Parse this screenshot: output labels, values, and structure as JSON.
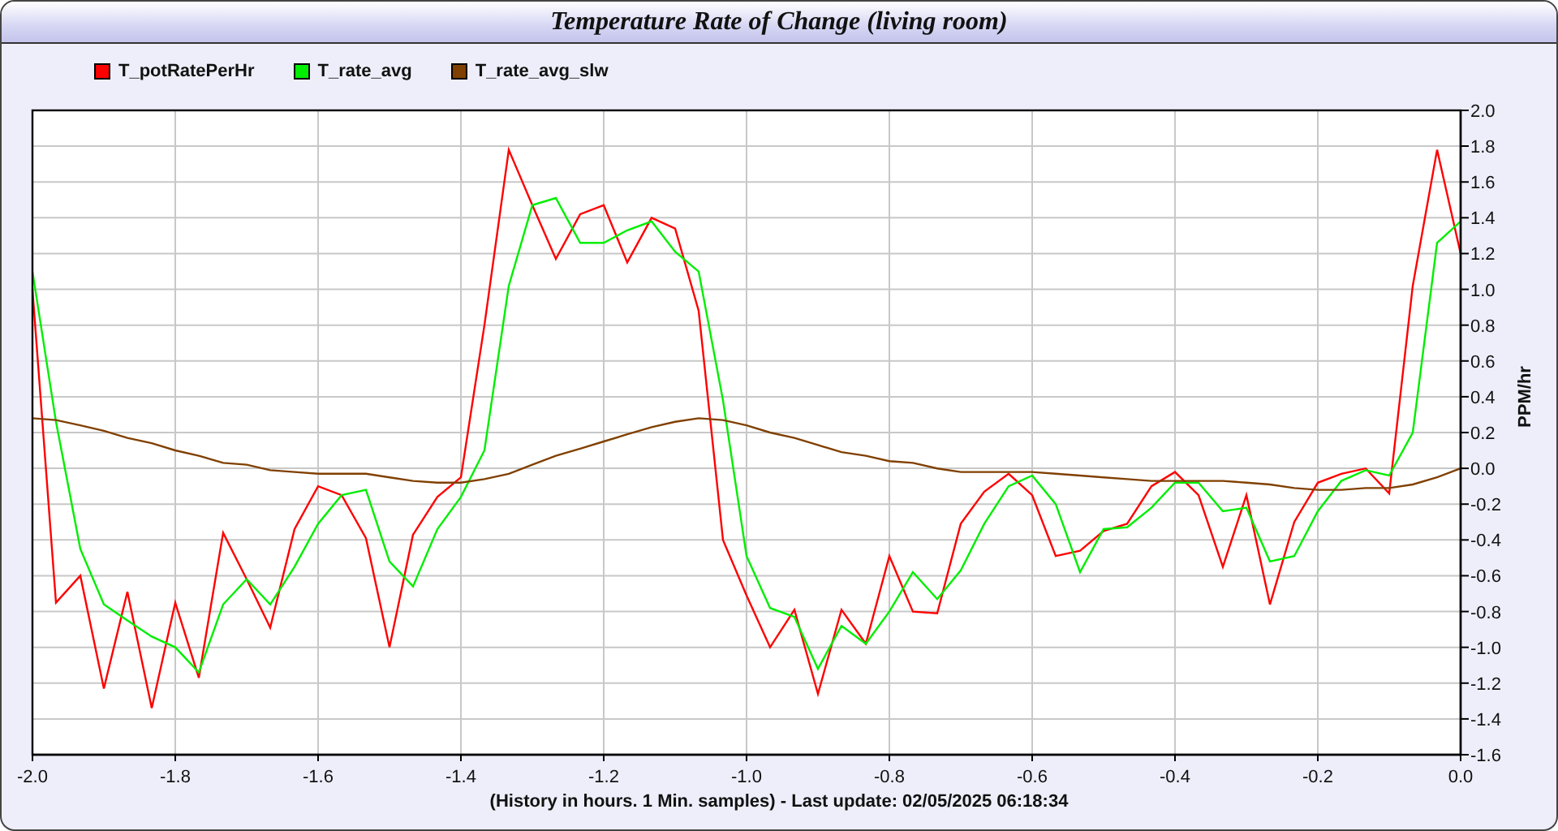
{
  "window": {
    "title": "Temperature Rate of Change (living room)"
  },
  "chart_data": {
    "type": "line",
    "xlabel": "(History in hours. 1 Min. samples) - Last update: 02/05/2025 06:18:34",
    "ylabel": "PPM/hr",
    "grid": true,
    "xlim": [
      -2.0,
      0.0
    ],
    "ylim": [
      -1.6,
      2.0
    ],
    "xticks": [
      {
        "value": -2.0,
        "label": "-2.0"
      },
      {
        "value": -1.8,
        "label": "-1.8"
      },
      {
        "value": -1.6,
        "label": "-1.6"
      },
      {
        "value": -1.4,
        "label": "-1.4"
      },
      {
        "value": -1.2,
        "label": "-1.2"
      },
      {
        "value": -1.0,
        "label": "-1.0"
      },
      {
        "value": -0.8,
        "label": "-0.8"
      },
      {
        "value": -0.6,
        "label": "-0.6"
      },
      {
        "value": -0.4,
        "label": "-0.4"
      },
      {
        "value": -0.2,
        "label": "-0.2"
      },
      {
        "value": 0.0,
        "label": "0.0"
      }
    ],
    "yticks": [
      {
        "value": 2.0,
        "label": "2.0"
      },
      {
        "value": 1.8,
        "label": "1.8"
      },
      {
        "value": 1.6,
        "label": "1.6"
      },
      {
        "value": 1.4,
        "label": "1.4"
      },
      {
        "value": 1.2,
        "label": "1.2"
      },
      {
        "value": 1.0,
        "label": "1.0"
      },
      {
        "value": 0.8,
        "label": "0.8"
      },
      {
        "value": 0.6,
        "label": "0.6"
      },
      {
        "value": 0.4,
        "label": "0.4"
      },
      {
        "value": 0.2,
        "label": "0.2"
      },
      {
        "value": 0.0,
        "label": "0.0"
      },
      {
        "value": -0.2,
        "label": "-0.2"
      },
      {
        "value": -0.4,
        "label": "-0.4"
      },
      {
        "value": -0.6,
        "label": "-0.6"
      },
      {
        "value": -0.8,
        "label": "-0.8"
      },
      {
        "value": -1.0,
        "label": "-1.0"
      },
      {
        "value": -1.2,
        "label": "-1.2"
      },
      {
        "value": -1.4,
        "label": "-1.4"
      },
      {
        "value": -1.6,
        "label": "-1.6"
      }
    ],
    "x": [
      -2.0,
      -1.967,
      -1.933,
      -1.9,
      -1.867,
      -1.833,
      -1.8,
      -1.767,
      -1.733,
      -1.7,
      -1.667,
      -1.633,
      -1.6,
      -1.567,
      -1.533,
      -1.5,
      -1.467,
      -1.433,
      -1.4,
      -1.367,
      -1.333,
      -1.3,
      -1.267,
      -1.233,
      -1.2,
      -1.167,
      -1.133,
      -1.1,
      -1.067,
      -1.033,
      -1.0,
      -0.967,
      -0.933,
      -0.9,
      -0.867,
      -0.833,
      -0.8,
      -0.767,
      -0.733,
      -0.7,
      -0.667,
      -0.633,
      -0.6,
      -0.567,
      -0.533,
      -0.5,
      -0.467,
      -0.433,
      -0.4,
      -0.367,
      -0.333,
      -0.3,
      -0.267,
      -0.233,
      -0.2,
      -0.167,
      -0.133,
      -0.1,
      -0.067,
      -0.033,
      0.0
    ],
    "series": [
      {
        "name": "T_potRatePerHr",
        "color": "#ff0000",
        "values": [
          1.0,
          -0.75,
          -0.6,
          -1.23,
          -0.69,
          -1.34,
          -0.75,
          -1.17,
          -0.36,
          -0.62,
          -0.89,
          -0.34,
          -0.1,
          -0.15,
          -0.39,
          -1.0,
          -0.37,
          -0.16,
          -0.05,
          0.8,
          1.78,
          1.47,
          1.17,
          1.42,
          1.47,
          1.15,
          1.4,
          1.34,
          0.88,
          -0.4,
          -0.71,
          -1.0,
          -0.79,
          -1.26,
          -0.79,
          -0.98,
          -0.49,
          -0.8,
          -0.81,
          -0.31,
          -0.13,
          -0.03,
          -0.15,
          -0.49,
          -0.46,
          -0.35,
          -0.31,
          -0.1,
          -0.02,
          -0.15,
          -0.55,
          -0.15,
          -0.76,
          -0.3,
          -0.08,
          -0.03,
          0.0,
          -0.14,
          1.02,
          1.78,
          1.2
        ]
      },
      {
        "name": "T_rate_avg",
        "color": "#00ee00",
        "values": [
          1.1,
          0.26,
          -0.45,
          -0.76,
          -0.85,
          -0.94,
          -1.0,
          -1.14,
          -0.76,
          -0.62,
          -0.76,
          -0.55,
          -0.31,
          -0.15,
          -0.12,
          -0.52,
          -0.66,
          -0.34,
          -0.16,
          0.1,
          1.02,
          1.47,
          1.51,
          1.26,
          1.26,
          1.33,
          1.38,
          1.21,
          1.1,
          0.38,
          -0.49,
          -0.78,
          -0.83,
          -1.12,
          -0.88,
          -0.98,
          -0.8,
          -0.58,
          -0.73,
          -0.57,
          -0.31,
          -0.1,
          -0.04,
          -0.2,
          -0.58,
          -0.34,
          -0.33,
          -0.22,
          -0.08,
          -0.08,
          -0.24,
          -0.22,
          -0.52,
          -0.49,
          -0.24,
          -0.07,
          -0.01,
          -0.04,
          0.2,
          1.26,
          1.38
        ]
      },
      {
        "name": "T_rate_avg_slw",
        "color": "#804000",
        "values": [
          0.28,
          0.27,
          0.24,
          0.21,
          0.17,
          0.14,
          0.1,
          0.07,
          0.03,
          0.02,
          -0.01,
          -0.02,
          -0.03,
          -0.03,
          -0.03,
          -0.05,
          -0.07,
          -0.08,
          -0.08,
          -0.06,
          -0.03,
          0.02,
          0.07,
          0.11,
          0.15,
          0.19,
          0.23,
          0.26,
          0.28,
          0.27,
          0.24,
          0.2,
          0.17,
          0.13,
          0.09,
          0.07,
          0.04,
          0.03,
          0.0,
          -0.02,
          -0.02,
          -0.02,
          -0.02,
          -0.03,
          -0.04,
          -0.05,
          -0.06,
          -0.07,
          -0.07,
          -0.07,
          -0.07,
          -0.08,
          -0.09,
          -0.11,
          -0.12,
          -0.12,
          -0.11,
          -0.11,
          -0.09,
          -0.05,
          0.0
        ]
      }
    ]
  }
}
